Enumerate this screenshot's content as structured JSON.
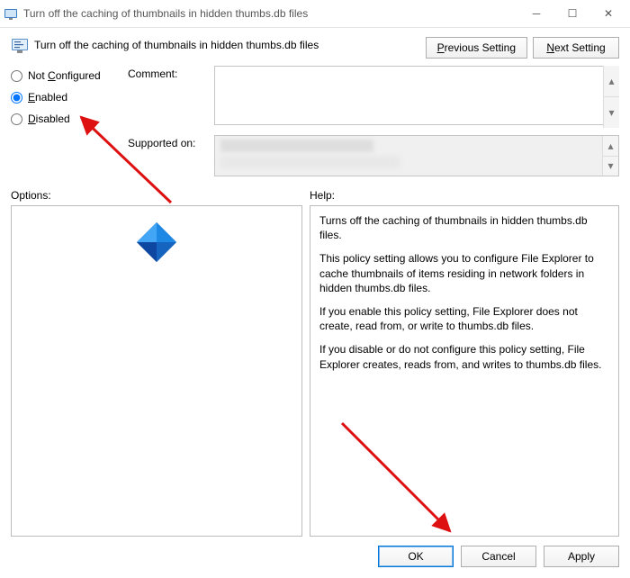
{
  "window": {
    "title": "Turn off the caching of thumbnails in hidden thumbs.db files"
  },
  "header": {
    "policy_title": "Turn off the caching of thumbnails in hidden thumbs.db files",
    "prev_btn": "Previous Setting",
    "next_btn": "Next Setting"
  },
  "radios": {
    "not_configured": "Not Configured",
    "enabled": "Enabled",
    "disabled": "Disabled",
    "selected": "enabled"
  },
  "fields": {
    "comment_label": "Comment:",
    "comment_value": "",
    "supported_label": "Supported on:"
  },
  "panes": {
    "options_label": "Options:",
    "help_label": "Help:",
    "help_p1": "Turns off the caching of thumbnails in hidden thumbs.db files.",
    "help_p2": "This policy setting allows you to configure File Explorer to cache thumbnails of items residing in network folders in hidden thumbs.db files.",
    "help_p3": "If you enable this policy setting, File Explorer does not create, read from, or write to thumbs.db files.",
    "help_p4": "If you disable or do not configure this policy setting, File Explorer creates, reads from, and writes to thumbs.db files."
  },
  "footer": {
    "ok": "OK",
    "cancel": "Cancel",
    "apply": "Apply"
  }
}
